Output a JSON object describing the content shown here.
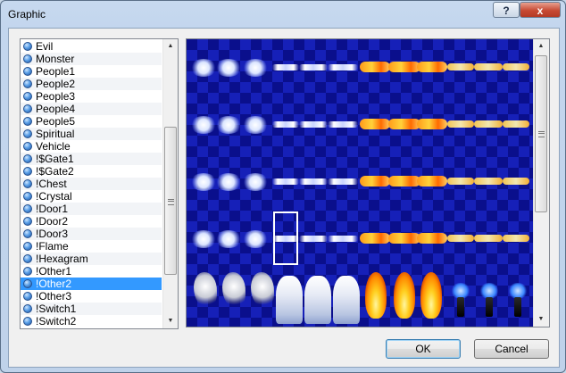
{
  "window": {
    "title": "Graphic",
    "help_label": "?",
    "close_label": "x"
  },
  "list": {
    "selected_index": 19,
    "items": [
      "Evil",
      "Monster",
      "People1",
      "People2",
      "People3",
      "People4",
      "People5",
      "Spiritual",
      "Vehicle",
      "!$Gate1",
      "!$Gate2",
      "!Chest",
      "!Crystal",
      "!Door1",
      "!Door2",
      "!Door3",
      "!Flame",
      "!Hexagram",
      "!Other1",
      "!Other2",
      "!Other3",
      "!Switch1",
      "!Switch2"
    ]
  },
  "icons": {
    "list_item": "blue-orb-icon",
    "scroll_up": "arrow-up-icon",
    "scroll_down": "arrow-down-icon"
  },
  "buttons": {
    "ok": "OK",
    "cancel": "Cancel"
  },
  "colors": {
    "selection": "#3399ff",
    "preview_bg": "#0a0f8c",
    "close_button": "#c74a33"
  }
}
